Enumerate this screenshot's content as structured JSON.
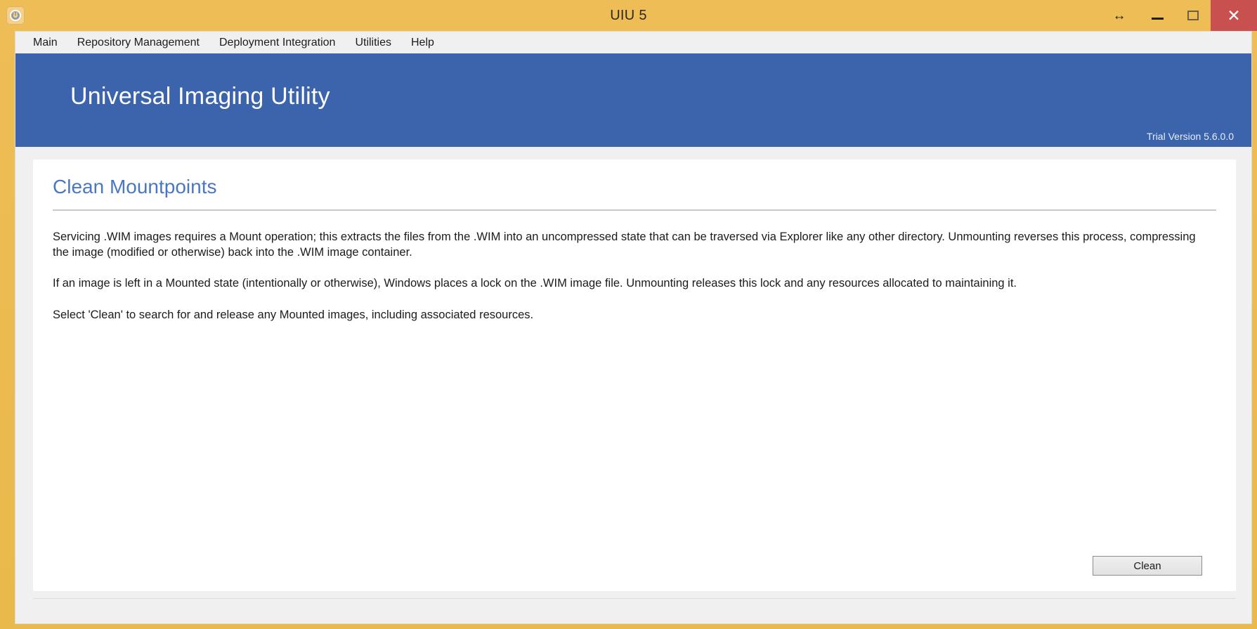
{
  "window": {
    "title": "UIU 5",
    "app_icon": "power-icon",
    "controls": {
      "resize": "resize-horizontal-icon",
      "minimize": "minimize-icon",
      "maximize": "maximize-icon",
      "close": "close-icon",
      "close_glyph": "✕",
      "resize_glyph": "↔"
    },
    "frame_color": "#eab94b"
  },
  "menu": {
    "items": [
      {
        "label": "Main",
        "name": "menu-item-main"
      },
      {
        "label": "Repository Management",
        "name": "menu-item-repository-management"
      },
      {
        "label": "Deployment Integration",
        "name": "menu-item-deployment-integration"
      },
      {
        "label": "Utilities",
        "name": "menu-item-utilities"
      },
      {
        "label": "Help",
        "name": "menu-item-help"
      }
    ]
  },
  "banner": {
    "title": "Universal Imaging Utility",
    "version": "Trial Version 5.6.0.0",
    "background_color": "#3b64ad",
    "text_color": "#ffffff"
  },
  "content": {
    "section_title": "Clean Mountpoints",
    "section_title_color": "#4a77c4",
    "paragraphs": [
      "Servicing .WIM images requires a Mount operation; this extracts the files from the .WIM into an uncompressed state that can be traversed via Explorer like any other directory. Unmounting reverses this process, compressing the image (modified or otherwise) back into the .WIM image container.",
      "If an image is left in a Mounted state (intentionally or otherwise), Windows places a lock on the .WIM image file. Unmounting releases this lock and any resources allocated to maintaining it.",
      "Select 'Clean' to search for and release any Mounted images, including associated resources."
    ]
  },
  "actions": {
    "clean_label": "Clean"
  },
  "status_bar": {
    "text": ""
  }
}
